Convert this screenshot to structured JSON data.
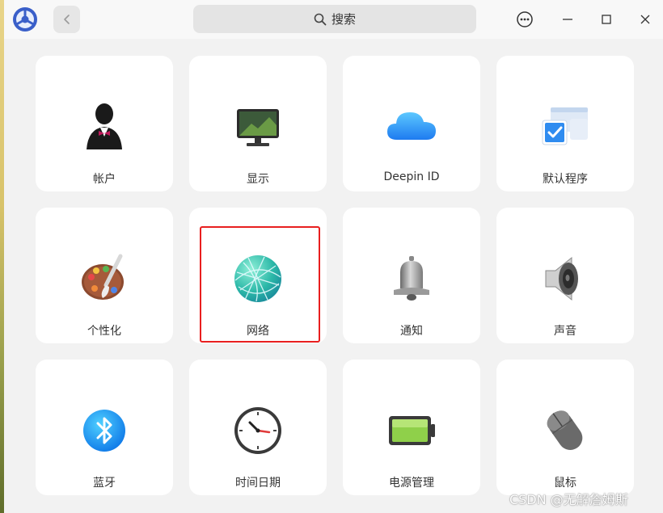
{
  "search": {
    "placeholder": "搜索"
  },
  "tiles": [
    {
      "label": "帐户",
      "icon": "user-avatar-icon"
    },
    {
      "label": "显示",
      "icon": "monitor-icon"
    },
    {
      "label": "Deepin ID",
      "icon": "cloud-icon"
    },
    {
      "label": "默认程序",
      "icon": "default-apps-icon"
    },
    {
      "label": "个性化",
      "icon": "palette-icon"
    },
    {
      "label": "网络",
      "icon": "network-globe-icon"
    },
    {
      "label": "通知",
      "icon": "bell-icon"
    },
    {
      "label": "声音",
      "icon": "speaker-icon"
    },
    {
      "label": "蓝牙",
      "icon": "bluetooth-icon"
    },
    {
      "label": "时间日期",
      "icon": "clock-icon"
    },
    {
      "label": "电源管理",
      "icon": "battery-icon"
    },
    {
      "label": "鼠标",
      "icon": "mouse-icon"
    }
  ],
  "selected_tile": "网络",
  "watermark": "CSDN @无解詹姆斯",
  "colors": {
    "highlight": "#e81f1f",
    "accent": "#2ca7f8"
  }
}
